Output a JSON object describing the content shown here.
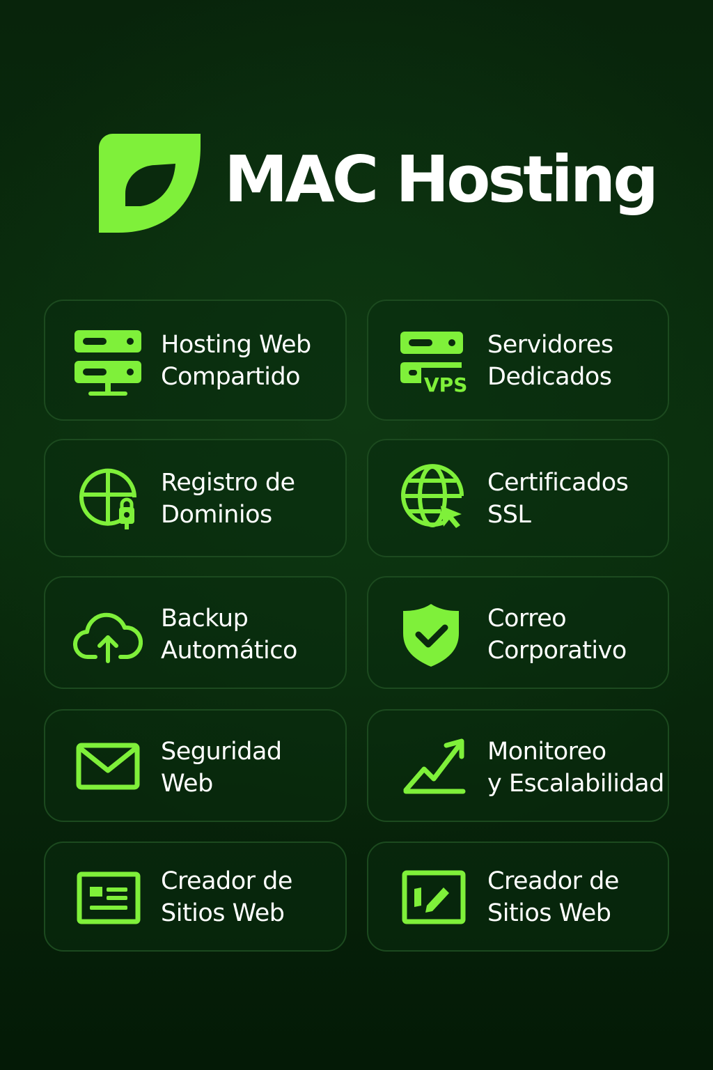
{
  "brand": {
    "name": "MAC Hosting",
    "logo_icon": "leaf-icon",
    "accent_color": "#7ff03a"
  },
  "services": [
    {
      "line1": "Hosting Web",
      "line2": "Compartido",
      "icon": "server-network-icon"
    },
    {
      "line1": "Servidores",
      "line2": "Dedicados",
      "icon": "server-vps-icon",
      "badge": "VPS"
    },
    {
      "line1": "Registro de",
      "line2": "Dominios",
      "icon": "globe-lock-icon"
    },
    {
      "line1": "Certificados",
      "line2": "SSL",
      "icon": "globe-cursor-icon"
    },
    {
      "line1": "Backup",
      "line2": "Automático",
      "icon": "cloud-upload-icon"
    },
    {
      "line1": "Correo",
      "line2": "Corporativo",
      "icon": "shield-check-icon"
    },
    {
      "line1": "Seguridad",
      "line2": "Web",
      "icon": "envelope-icon"
    },
    {
      "line1": "Monitoreo",
      "line2": "y Escalabilidad",
      "icon": "trending-up-icon"
    },
    {
      "line1": "Creador de",
      "line2": "Sitios Web",
      "icon": "website-layout-icon"
    },
    {
      "line1": "Creador de",
      "line2": "Sitios Web",
      "icon": "website-edit-icon"
    }
  ]
}
